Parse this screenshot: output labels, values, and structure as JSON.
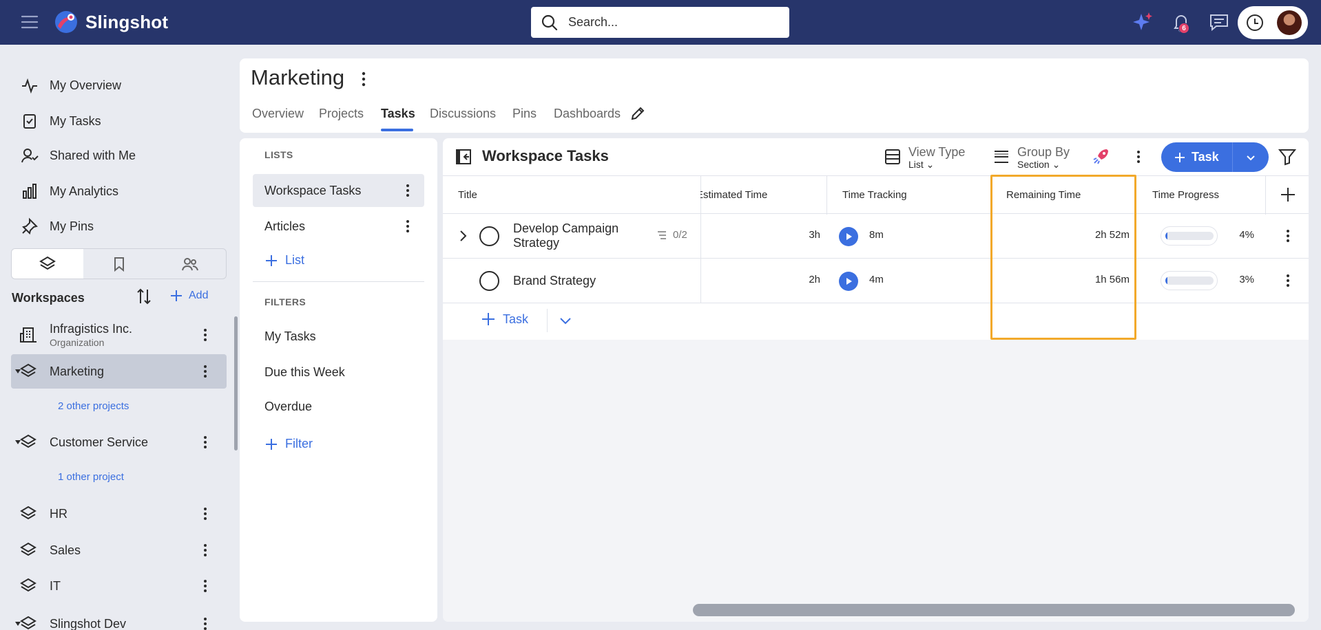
{
  "app": {
    "name": "Slingshot"
  },
  "search": {
    "placeholder": "Search..."
  },
  "notifications": {
    "count": "6"
  },
  "nav": [
    {
      "label": "My Overview",
      "icon": "activity-icon"
    },
    {
      "label": "My Tasks",
      "icon": "clipboard-check-icon"
    },
    {
      "label": "Shared with Me",
      "icon": "user-share-icon"
    },
    {
      "label": "My Analytics",
      "icon": "bar-chart-icon"
    },
    {
      "label": "My Pins",
      "icon": "pin-icon"
    }
  ],
  "workspaces": {
    "heading": "Workspaces",
    "add_label": "Add",
    "items": [
      {
        "name": "Infragistics Inc.",
        "sub": "Organization"
      },
      {
        "name": "Marketing",
        "other": "2 other projects"
      },
      {
        "name": "Customer Service",
        "other": "1 other project"
      },
      {
        "name": "HR"
      },
      {
        "name": "Sales"
      },
      {
        "name": "IT"
      },
      {
        "name": "Slingshot Dev"
      }
    ]
  },
  "page": {
    "title": "Marketing",
    "tabs": [
      "Overview",
      "Projects",
      "Tasks",
      "Discussions",
      "Pins",
      "Dashboards"
    ],
    "active_tab": "Tasks"
  },
  "lists": {
    "lists_label": "LISTS",
    "items": [
      "Workspace Tasks",
      "Articles"
    ],
    "add_list": "List",
    "filters_label": "FILTERS",
    "filters": [
      "My Tasks",
      "Due this Week",
      "Overdue"
    ],
    "add_filter": "Filter"
  },
  "tasks": {
    "title": "Workspace Tasks",
    "view_type": {
      "label": "View Type",
      "value": "List"
    },
    "group_by": {
      "label": "Group By",
      "value": "Section"
    },
    "task_button": "Task",
    "columns": [
      "Title",
      "Estimated Time",
      "Time Tracking",
      "Remaining Time",
      "Time Progress"
    ],
    "rows": [
      {
        "title": "Develop Campaign Strategy",
        "subtasks": "0/2",
        "estimated": "3h",
        "tracked": "8m",
        "remaining": "2h 52m",
        "progress_pct": 4,
        "progress": "4%"
      },
      {
        "title": "Brand Strategy",
        "subtasks": "",
        "estimated": "2h",
        "tracked": "4m",
        "remaining": "1h 56m",
        "progress_pct": 3,
        "progress": "3%"
      }
    ],
    "add_task": "Task"
  },
  "colors": {
    "topbar": "#27356b",
    "accent": "#3b6fe0",
    "highlight": "#f2a92b",
    "badge": "#e3416a"
  }
}
